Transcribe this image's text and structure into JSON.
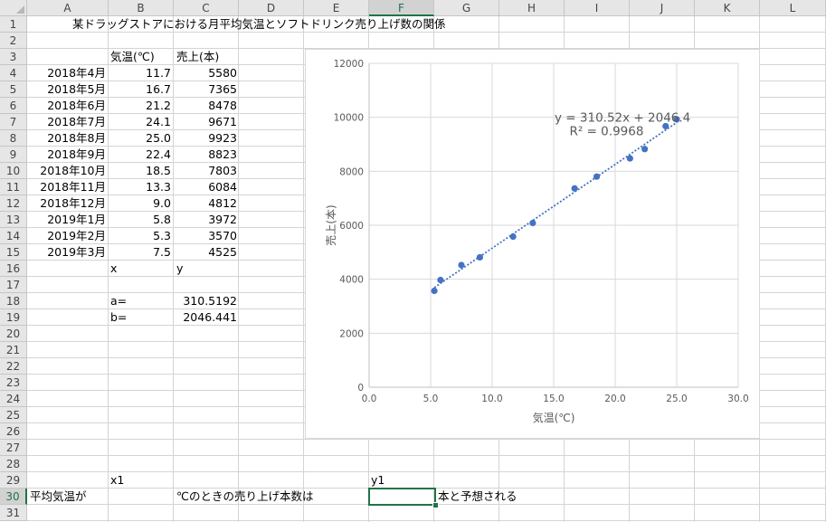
{
  "columns": [
    "A",
    "B",
    "C",
    "D",
    "E",
    "F",
    "G",
    "H",
    "I",
    "J",
    "K",
    "L"
  ],
  "rows": [
    "1",
    "2",
    "3",
    "4",
    "5",
    "6",
    "7",
    "8",
    "9",
    "10",
    "11",
    "12",
    "13",
    "14",
    "15",
    "16",
    "17",
    "18",
    "19",
    "20",
    "21",
    "22",
    "23",
    "24",
    "25",
    "26",
    "27",
    "28",
    "29",
    "30",
    "31"
  ],
  "title": "某ドラッグストアにおける月平均気温とソフトドリンク売り上げ数の関係",
  "headers": {
    "temp": "気温(℃)",
    "sales": "売上(本)"
  },
  "table": [
    {
      "month": "2018年4月",
      "temp": "11.7",
      "sales": "5580"
    },
    {
      "month": "2018年5月",
      "temp": "16.7",
      "sales": "7365"
    },
    {
      "month": "2018年6月",
      "temp": "21.2",
      "sales": "8478"
    },
    {
      "month": "2018年7月",
      "temp": "24.1",
      "sales": "9671"
    },
    {
      "month": "2018年8月",
      "temp": "25.0",
      "sales": "9923"
    },
    {
      "month": "2018年9月",
      "temp": "22.4",
      "sales": "8823"
    },
    {
      "month": "2018年10月",
      "temp": "18.5",
      "sales": "7803"
    },
    {
      "month": "2018年11月",
      "temp": "13.3",
      "sales": "6084"
    },
    {
      "month": "2018年12月",
      "temp": "9.0",
      "sales": "4812"
    },
    {
      "month": "2019年1月",
      "temp": "5.8",
      "sales": "3972"
    },
    {
      "month": "2019年2月",
      "temp": "5.3",
      "sales": "3570"
    },
    {
      "month": "2019年3月",
      "temp": "7.5",
      "sales": "4525"
    }
  ],
  "row16": {
    "x": "x",
    "y": "y"
  },
  "coef": {
    "a_label": "a=",
    "a_value": "310.5192",
    "b_label": "b=",
    "b_value": "2046.441"
  },
  "row29": {
    "x1": "x1",
    "y1": "y1"
  },
  "row30": {
    "prefix": "平均気温が",
    "middle": "℃のときの売り上げ本数は",
    "suffix": "本と予想される"
  },
  "selected": {
    "column": "F",
    "row": "30"
  },
  "chart_data": {
    "type": "scatter",
    "xlabel": "気温(℃)",
    "ylabel": "売上(本)",
    "xlim": [
      0,
      30
    ],
    "ylim": [
      0,
      12000
    ],
    "xticks": [
      "0.0",
      "5.0",
      "10.0",
      "15.0",
      "20.0",
      "25.0",
      "30.0"
    ],
    "yticks": [
      "0",
      "2000",
      "4000",
      "6000",
      "8000",
      "10000",
      "12000"
    ],
    "x": [
      11.7,
      16.7,
      21.2,
      24.1,
      25.0,
      22.4,
      18.5,
      13.3,
      9.0,
      5.8,
      5.3,
      7.5
    ],
    "y": [
      5580,
      7365,
      8478,
      9671,
      9923,
      8823,
      7803,
      6084,
      4812,
      3972,
      3570,
      4525
    ],
    "trendline": {
      "slope": 310.52,
      "intercept": 2046.4,
      "x_range": [
        5.3,
        25.0
      ]
    },
    "equation": "y = 310.52x + 2046.4",
    "r2": "R² = 0.9968",
    "grid": true,
    "color": "#4472c4"
  }
}
